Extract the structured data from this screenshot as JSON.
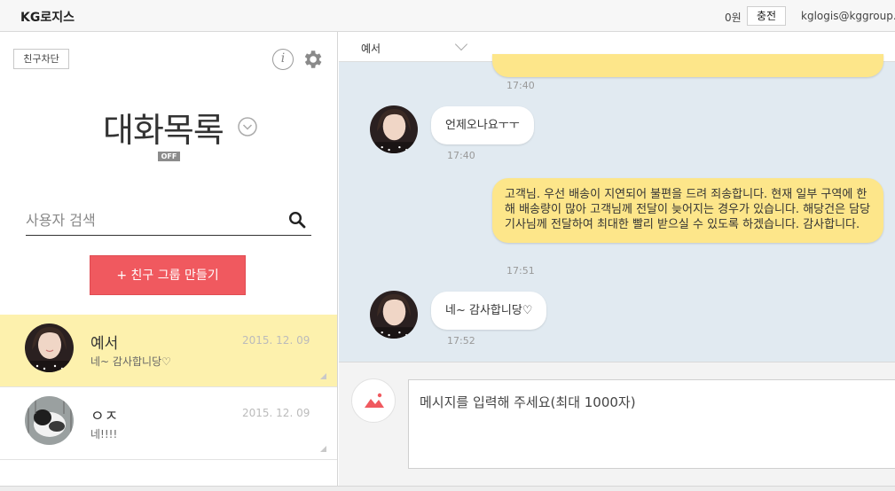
{
  "topbar": {
    "brand": "KG로지스",
    "points": "0원",
    "charge_label": "충전",
    "email": "kglogis@kggroup.c"
  },
  "sidebar": {
    "block_label": "친구차단",
    "title": "대화목록",
    "status_badge": "OFF",
    "search_placeholder": "사용자 검색",
    "group_button": "+ 친구 그룹 만들기",
    "friends": [
      {
        "name": "예서",
        "date": "2015. 12. 09",
        "preview": "네~ 감사합니당♡",
        "active": true
      },
      {
        "name": "ㅇㅈ",
        "date": "2015. 12. 09",
        "preview": "네!!!!",
        "active": false
      }
    ]
  },
  "chat": {
    "partner": "예서",
    "messages": [
      {
        "from": "me",
        "text": "",
        "time": "17:40"
      },
      {
        "from": "them",
        "text": "언제오나요ㅜㅜ",
        "time": "17:40"
      },
      {
        "from": "me",
        "text": "고객님. 우선 배송이 지연되어 불편을 드려 죄송합니다. 현재 일부 구역에 한해 배송량이 많아 고객님께 전달이 늦어지는 경우가 있습니다. 해당건은 담당 기사님께 전달하여 최대한 빨리 받으실 수 있도록 하겠습니다. 감사합니다.",
        "time": "17:51"
      },
      {
        "from": "them",
        "text": "네~ 감사합니당♡",
        "time": "17:52"
      }
    ],
    "input_placeholder": "메시지를 입력해 주세요(최대 1000자)"
  },
  "colors": {
    "accent_red": "#f0595f",
    "my_bubble": "#fde68a",
    "active_row": "#fdf1ad",
    "chat_bg": "#e1eaf1"
  }
}
